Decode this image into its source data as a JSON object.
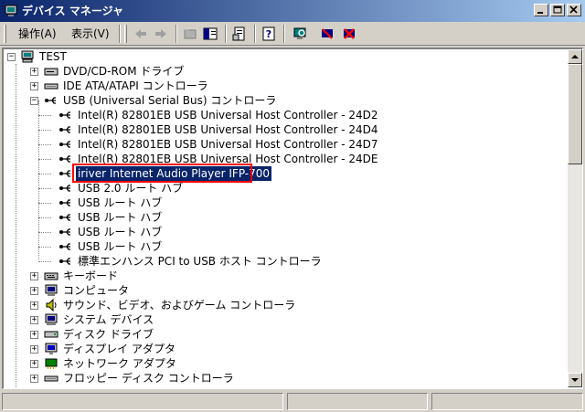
{
  "window": {
    "title": "デバイス マネージャ",
    "icon": "computer-icon"
  },
  "menu": {
    "action": "操作(A)",
    "view": "表示(V)"
  },
  "toolbar": {
    "icons": [
      "back-arrow-icon",
      "forward-arrow-icon",
      "up-folder-icon",
      "show-hide-tree-icon",
      "properties-icon",
      "help-icon",
      "scan-hardware-icon",
      "disable-device-icon",
      "uninstall-device-icon"
    ]
  },
  "tree": {
    "root": "TEST",
    "categories": [
      {
        "label": "DVD/CD-ROM ドライブ",
        "icon": "dvd-drive-icon"
      },
      {
        "label": "IDE ATA/ATAPI コントローラ",
        "icon": "ide-controller-icon"
      },
      {
        "label": "USB (Universal Serial Bus) コントローラ",
        "icon": "usb-icon"
      }
    ],
    "usb_children": [
      "Intel(R) 82801EB USB Universal Host Controller - 24D2",
      "Intel(R) 82801EB USB Universal Host Controller - 24D4",
      "Intel(R) 82801EB USB Universal Host Controller - 24D7",
      "Intel(R) 82801EB USB Universal Host Controller - 24DE",
      "iriver Internet Audio Player IFP-700",
      "USB 2.0 ルート ハブ",
      "USB ルート ハブ",
      "USB ルート ハブ",
      "USB ルート ハブ",
      "USB ルート ハブ",
      "標準エンハンス PCI to USB ホスト コントローラ"
    ],
    "selected_index": 4,
    "other_categories": [
      {
        "label": "キーボード",
        "icon": "keyboard-icon"
      },
      {
        "label": "コンピュータ",
        "icon": "computer-icon"
      },
      {
        "label": "サウンド、ビデオ、およびゲーム コントローラ",
        "icon": "speaker-icon"
      },
      {
        "label": "システム デバイス",
        "icon": "system-device-icon"
      },
      {
        "label": "ディスク ドライブ",
        "icon": "disk-drive-icon"
      },
      {
        "label": "ディスプレイ アダプタ",
        "icon": "display-adapter-icon"
      },
      {
        "label": "ネットワーク アダプタ",
        "icon": "network-adapter-icon"
      },
      {
        "label": "フロッピー ディスク コントローラ",
        "icon": "floppy-controller-icon"
      }
    ]
  },
  "colors": {
    "selection": "#0a246a",
    "highlight_box": "#ff0000",
    "face": "#d4d0c8"
  }
}
